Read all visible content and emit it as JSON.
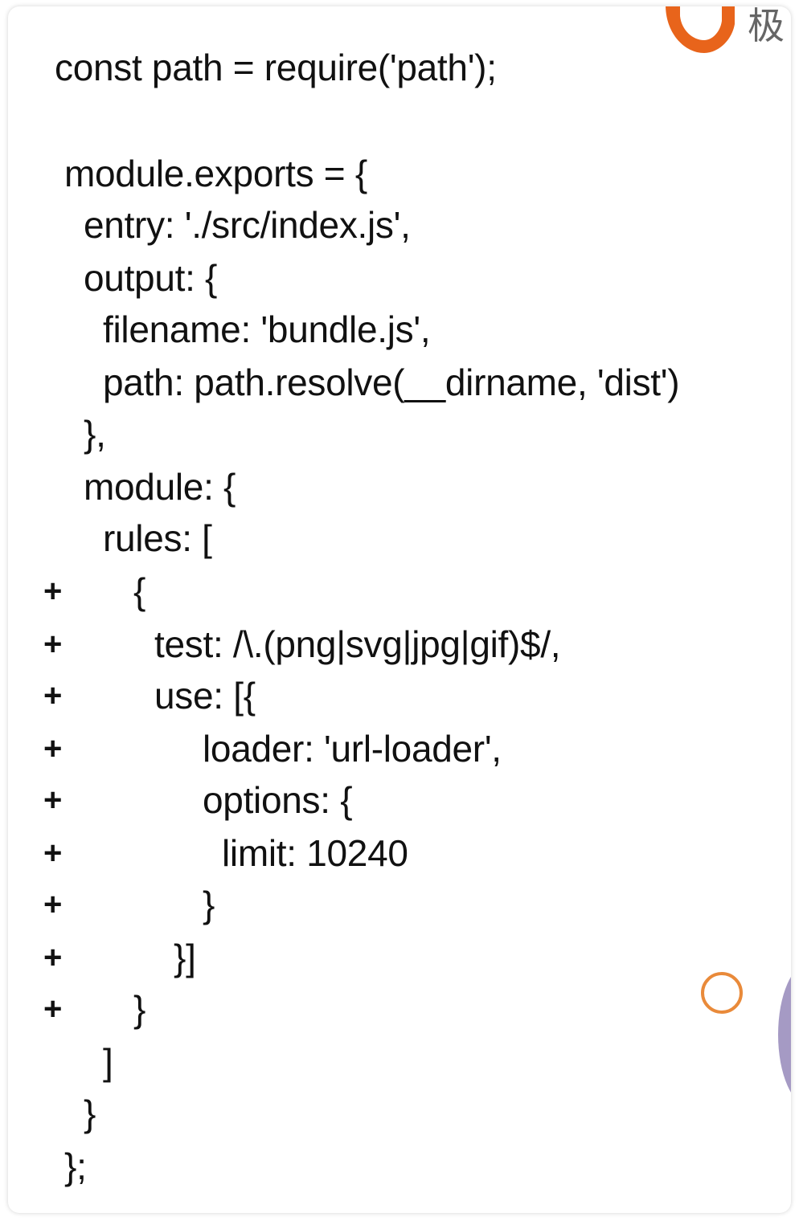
{
  "brand": {
    "logo_text": "极",
    "logo_color": "#e8641b"
  },
  "code_lines": [
    {
      "text": "const path = require('path');",
      "added": false
    },
    {
      "text": "module.exports = {",
      "added": false
    },
    {
      "text": "entry: './src/index.js',",
      "added": false
    },
    {
      "text": "output: {",
      "added": false
    },
    {
      "text": "filename: 'bundle.js',",
      "added": false
    },
    {
      "text": "path: path.resolve(__dirname, 'dist')",
      "added": false
    },
    {
      "text": "},",
      "added": false
    },
    {
      "text": "module: {",
      "added": false
    },
    {
      "text": "rules: [",
      "added": false
    },
    {
      "text": "{",
      "added": true
    },
    {
      "text": "test: /\\.(png|svg|jpg|gif)$/,",
      "added": true
    },
    {
      "text": "use: [{",
      "added": true
    },
    {
      "text": "loader: 'url-loader',",
      "added": true
    },
    {
      "text": "options: {",
      "added": true
    },
    {
      "text": "limit: 10240",
      "added": true
    },
    {
      "text": "}",
      "added": true
    },
    {
      "text": "}]",
      "added": true
    },
    {
      "text": "}",
      "added": true
    },
    {
      "text": "]",
      "added": false
    },
    {
      "text": "}",
      "added": false
    },
    {
      "text": "};",
      "added": false
    }
  ],
  "diff_marker": "+",
  "colors": {
    "ring": "#e98a3a",
    "side_blob": "#a59ac4",
    "text": "#111111"
  }
}
